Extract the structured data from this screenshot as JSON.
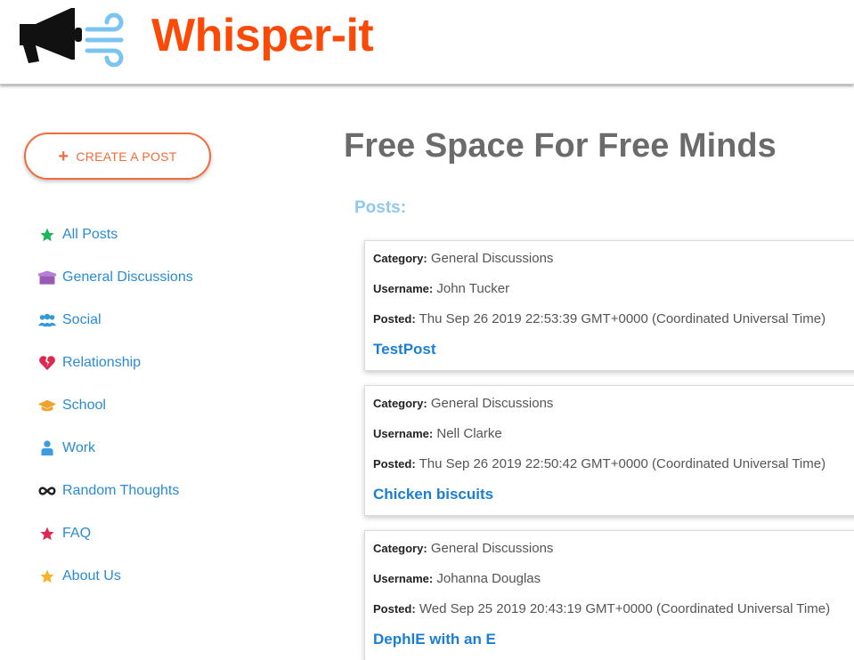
{
  "header": {
    "brand": "Whisper-it",
    "logo_icon": "megaphone-icon"
  },
  "sidebar": {
    "create_label": "CREATE A POST",
    "create_icon_glyph": "+",
    "items": [
      {
        "label": "All Posts",
        "icon": "star-icon",
        "color": "#1bb55c"
      },
      {
        "label": "General Discussions",
        "icon": "box-icon",
        "color": "#9b59b6"
      },
      {
        "label": "Social",
        "icon": "users-icon",
        "color": "#3498db"
      },
      {
        "label": "Relationship",
        "icon": "broken-heart-icon",
        "color": "#e0284f"
      },
      {
        "label": "School",
        "icon": "graduation-cap-icon",
        "color": "#f0a32c"
      },
      {
        "label": "Work",
        "icon": "worker-icon",
        "color": "#3d9be0"
      },
      {
        "label": "Random Thoughts",
        "icon": "infinity-icon",
        "color": "#222222"
      },
      {
        "label": "FAQ",
        "icon": "star-icon",
        "color": "#e0284f"
      },
      {
        "label": "About Us",
        "icon": "star-icon",
        "color": "#f6b42a"
      }
    ]
  },
  "main": {
    "hero": "Free Space For Free Minds",
    "posts_label": "Posts:",
    "field_labels": {
      "category": "Category:",
      "username": "Username:",
      "posted": "Posted:"
    },
    "posts": [
      {
        "category": "General Discussions",
        "username": "John Tucker",
        "posted": "Thu Sep 26 2019 22:53:39 GMT+0000 (Coordinated Universal Time)",
        "title": "TestPost"
      },
      {
        "category": "General Discussions",
        "username": "Nell Clarke",
        "posted": "Thu Sep 26 2019 22:50:42 GMT+0000 (Coordinated Universal Time)",
        "title": "Chicken biscuits"
      },
      {
        "category": "General Discussions",
        "username": "Johanna Douglas",
        "posted": "Wed Sep 25 2019 20:43:19 GMT+0000 (Coordinated Universal Time)",
        "title": "DephlE with an E"
      }
    ]
  },
  "colors": {
    "brand": "#fb4a07",
    "accent": "#f26b3a",
    "link": "#1a7fd4",
    "nav": "#2a8bd6"
  }
}
